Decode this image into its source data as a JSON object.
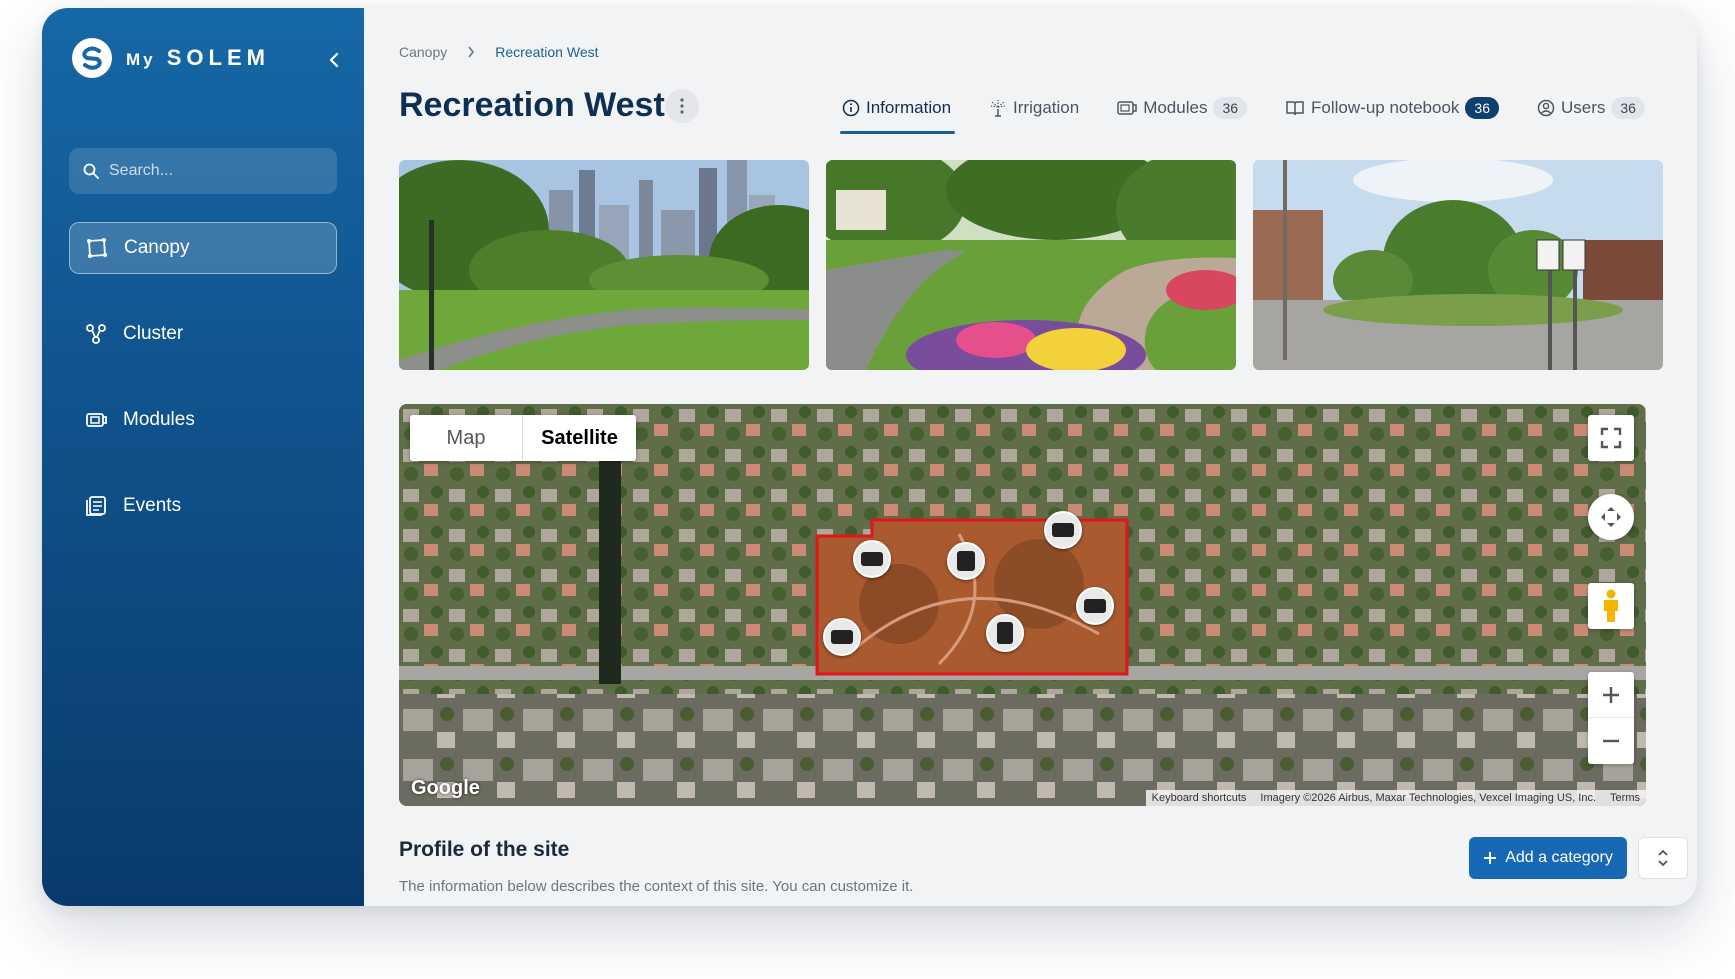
{
  "brand": {
    "name_prefix": "My",
    "name": "SOLEM"
  },
  "sidebar": {
    "search_placeholder": "Search...",
    "items": [
      {
        "label": "Canopy",
        "icon": "canopy-icon",
        "active": true
      },
      {
        "label": "Cluster",
        "icon": "cluster-icon",
        "active": false
      },
      {
        "label": "Modules",
        "icon": "modules-icon",
        "active": false
      },
      {
        "label": "Events",
        "icon": "events-icon",
        "active": false
      }
    ]
  },
  "breadcrumb": {
    "root": "Canopy",
    "current": "Recreation West"
  },
  "page": {
    "title": "Recreation West"
  },
  "tabs": [
    {
      "label": "Information",
      "icon": "info-icon",
      "active": true
    },
    {
      "label": "Irrigation",
      "icon": "sprinkler-icon"
    },
    {
      "label": "Modules",
      "icon": "modules-icon",
      "count": "36"
    },
    {
      "label": "Follow-up notebook",
      "icon": "notebook-icon",
      "count": "36"
    },
    {
      "label": "Users",
      "icon": "user-icon",
      "count": "36"
    }
  ],
  "photos": [
    "park-skyline-photo",
    "park-path-flowers-photo",
    "roundabout-street-photo"
  ],
  "map": {
    "type_options": [
      "Map",
      "Satellite"
    ],
    "selected_type": "Satellite",
    "logo": "Google",
    "attribution": {
      "shortcuts": "Keyboard shortcuts",
      "imagery": "Imagery ©2026 Airbus, Maxar Technologies, Vexcel Imaging US, Inc.",
      "terms": "Terms"
    },
    "zone_outline_color": "#e0161b",
    "module_markers": 6
  },
  "profile": {
    "title": "Profile of the site",
    "description": "The information below describes the context of this site. You can customize it.",
    "add_button": "Add a category"
  },
  "colors": {
    "accent": "#1769b5",
    "sidebar": "#10528c",
    "title": "#0f2f52"
  }
}
